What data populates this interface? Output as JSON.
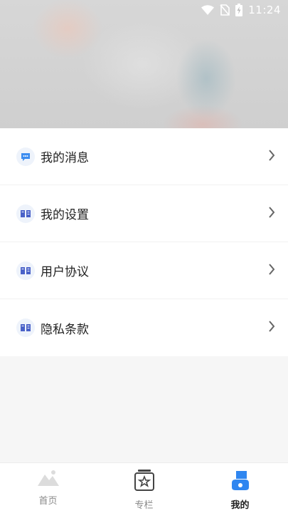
{
  "status_bar": {
    "time": "11:24",
    "icons": [
      "wifi-icon",
      "no-sim-icon",
      "battery-charging-icon"
    ]
  },
  "menu": {
    "items": [
      {
        "label": "我的消息",
        "icon": "message-icon",
        "icon_color": "#3b8cf0"
      },
      {
        "label": "我的设置",
        "icon": "book-icon",
        "icon_color": "#4a62c8"
      },
      {
        "label": "用户协议",
        "icon": "book-icon",
        "icon_color": "#4a62c8"
      },
      {
        "label": "隐私条款",
        "icon": "book-icon",
        "icon_color": "#4a62c8"
      }
    ]
  },
  "tabbar": {
    "tabs": [
      {
        "label": "首页",
        "icon": "mountain-icon",
        "active": false
      },
      {
        "label": "专栏",
        "icon": "star-card-icon",
        "active": false
      },
      {
        "label": "我的",
        "icon": "user-icon",
        "active": true
      }
    ],
    "active_color": "#2f86f0"
  }
}
